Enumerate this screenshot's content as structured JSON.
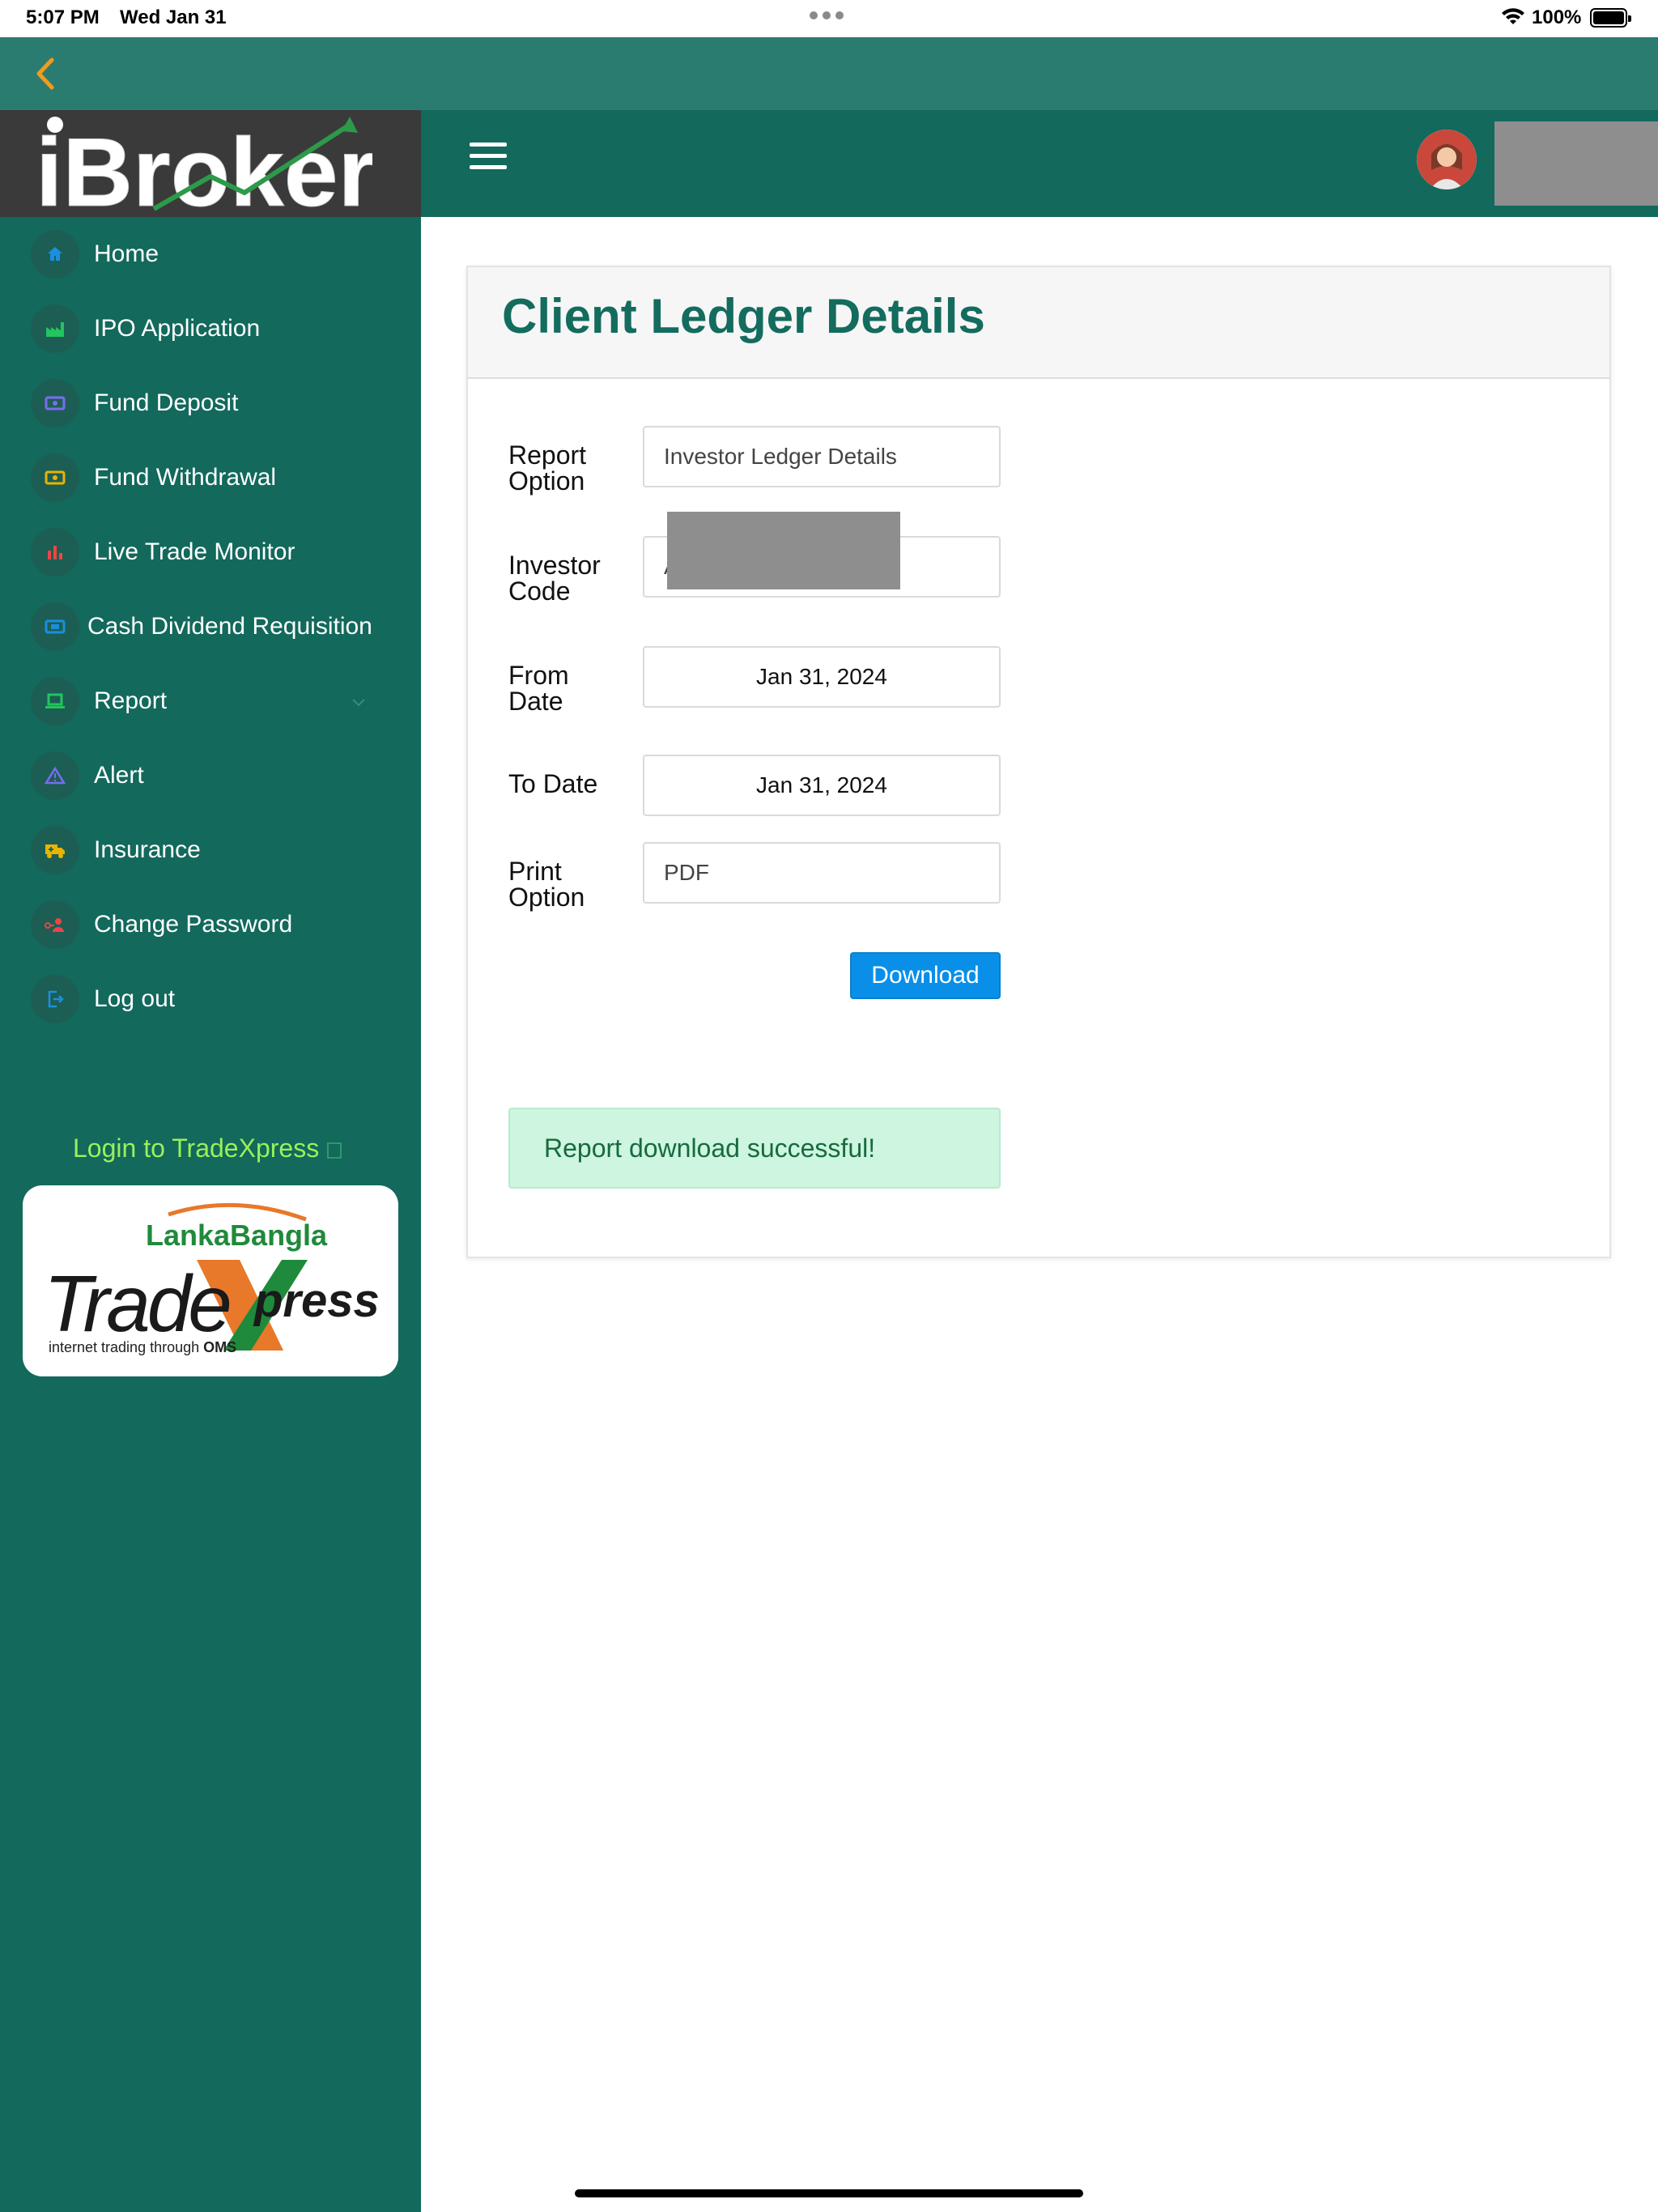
{
  "status_bar": {
    "time": "5:07 PM",
    "date": "Wed Jan 31",
    "battery": "100%"
  },
  "brand": {
    "logo_text": "iBroker"
  },
  "sidebar": {
    "items": [
      {
        "label": "Home",
        "icon": "home-icon",
        "color": "#1a8fe0"
      },
      {
        "label": "IPO Application",
        "icon": "factory-icon",
        "color": "#22c55e"
      },
      {
        "label": "Fund Deposit",
        "icon": "money-icon",
        "color": "#7b6cf0"
      },
      {
        "label": "Fund Withdrawal",
        "icon": "cash-icon",
        "color": "#e8b400"
      },
      {
        "label": "Live Trade Monitor",
        "icon": "bar-chart-icon",
        "color": "#ef4444"
      },
      {
        "label": "Cash Dividend Requisition",
        "icon": "cash-dividend-icon",
        "color": "#1a8fe0"
      },
      {
        "label": "Report",
        "icon": "laptop-icon",
        "color": "#22c55e"
      },
      {
        "label": "Alert",
        "icon": "warning-icon",
        "color": "#7b6cf0"
      },
      {
        "label": "Insurance",
        "icon": "ambulance-icon",
        "color": "#e8b400"
      },
      {
        "label": "Change Password",
        "icon": "user-key-icon",
        "color": "#ef4444"
      },
      {
        "label": "Log out",
        "icon": "logout-icon",
        "color": "#1a8fe0"
      }
    ],
    "login_link": "Login to TradeXpress"
  },
  "tradexpress": {
    "brand_top": "LankaBangla",
    "brand_main_1": "Trade",
    "brand_main_2": "press",
    "tagline_1": "internet trading through ",
    "tagline_2": "OMS"
  },
  "page": {
    "title": "Client Ledger Details"
  },
  "form": {
    "report_option_label_1": "Report",
    "report_option_label_2": "Option",
    "report_option_value": "Investor Ledger Details",
    "investor_code_label_1": "Investor",
    "investor_code_label_2": "Code",
    "investor_code_value": "A",
    "from_date_label_1": "From",
    "from_date_label_2": "Date",
    "from_date_value": "Jan 31, 2024",
    "to_date_label": "To Date",
    "to_date_value": "Jan 31, 2024",
    "print_option_label_1": "Print",
    "print_option_label_2": "Option",
    "print_option_value": "PDF",
    "download_label": "Download"
  },
  "alert": {
    "message": "Report download successful!"
  },
  "colors": {
    "sidebar_bg": "#12695c",
    "title": "#136c5e",
    "button": "#0a8fe8",
    "success_bg": "#cdf5df"
  }
}
